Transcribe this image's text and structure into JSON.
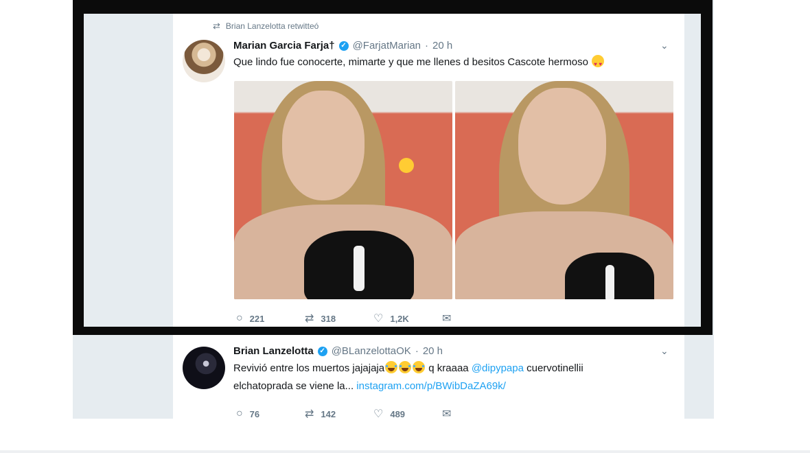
{
  "colors": {
    "link": "#1da1f2",
    "verified": "#1da1f2",
    "muted": "#657786",
    "frame": "#0b0b0b"
  },
  "retweet_context": {
    "icon": "retweet-icon",
    "text": "Brian Lanzelotta retwitteó"
  },
  "tweets": [
    {
      "name": "Marian Garcia Farja†",
      "verified": true,
      "handle": "@FarjatMarian",
      "separator": "·",
      "time": "20 h",
      "text": "Que lindo fue conocerte, mimarte y que me llenes d besitos Cascote hermoso",
      "emoji": "heart-eyes",
      "media_count": 2,
      "actions": {
        "replies": "221",
        "retweets": "318",
        "likes": "1,2K"
      }
    },
    {
      "name": "Brian Lanzelotta",
      "verified": true,
      "handle": "@BLanzelottaOK",
      "separator": "·",
      "time": "20 h",
      "text_1": "Revivió entre los muertos jajajaja",
      "emoji": "laughing-tears",
      "text_2": " q kraaaa ",
      "mention": "@dipypapa",
      "text_3": " cuervotinellii",
      "line2_text": "elchatoprada se viene la... ",
      "line2_link": "instagram.com/p/BWibDaZA69k/",
      "actions": {
        "replies": "76",
        "retweets": "142",
        "likes": "489"
      }
    }
  ]
}
